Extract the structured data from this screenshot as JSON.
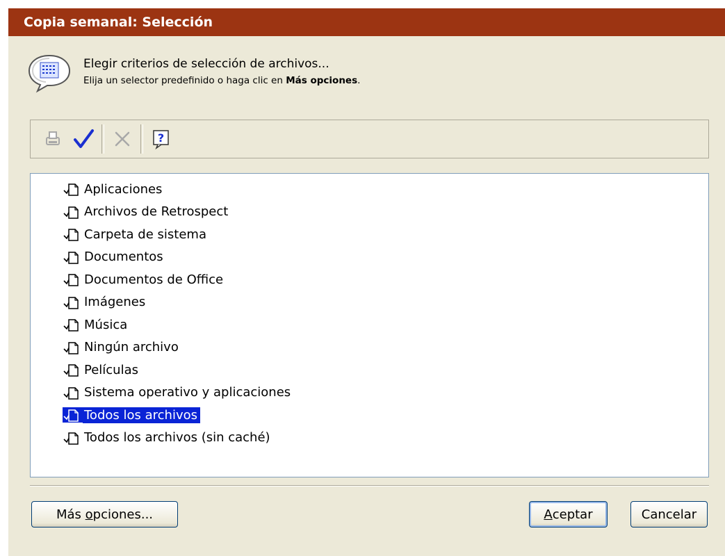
{
  "window": {
    "title": "Copia semanal: Selección"
  },
  "header": {
    "main_text": "Elegir criterios de selección de archivos...",
    "sub_text_prefix": "Elija un selector predefinido o haga clic en ",
    "sub_text_bold": "Más opciones",
    "sub_text_suffix": "."
  },
  "toolbar": {
    "buttons": [
      {
        "icon": "print-icon",
        "enabled": false
      },
      {
        "icon": "checkmark-icon",
        "enabled": true
      },
      {
        "icon": "delete-x-icon",
        "enabled": false
      },
      {
        "icon": "help-icon",
        "enabled": true
      }
    ]
  },
  "list": {
    "items": [
      "Aplicaciones",
      "Archivos de Retrospect",
      "Carpeta de sistema",
      "Documentos",
      "Documentos de Office",
      "Imágenes",
      "Música",
      "Ningún archivo",
      "Películas",
      "Sistema operativo y aplicaciones",
      "Todos los archivos",
      "Todos los archivos (sin caché)"
    ],
    "selected_index": 10
  },
  "buttons": {
    "more_options_prefix": "Más ",
    "more_options_underlined": "o",
    "more_options_suffix": "pciones...",
    "ok_underlined": "A",
    "ok_suffix": "ceptar",
    "cancel": "Cancelar"
  },
  "colors": {
    "titlebar": "#9c3412",
    "background": "#ece9d8",
    "selection": "#0a24d6"
  }
}
